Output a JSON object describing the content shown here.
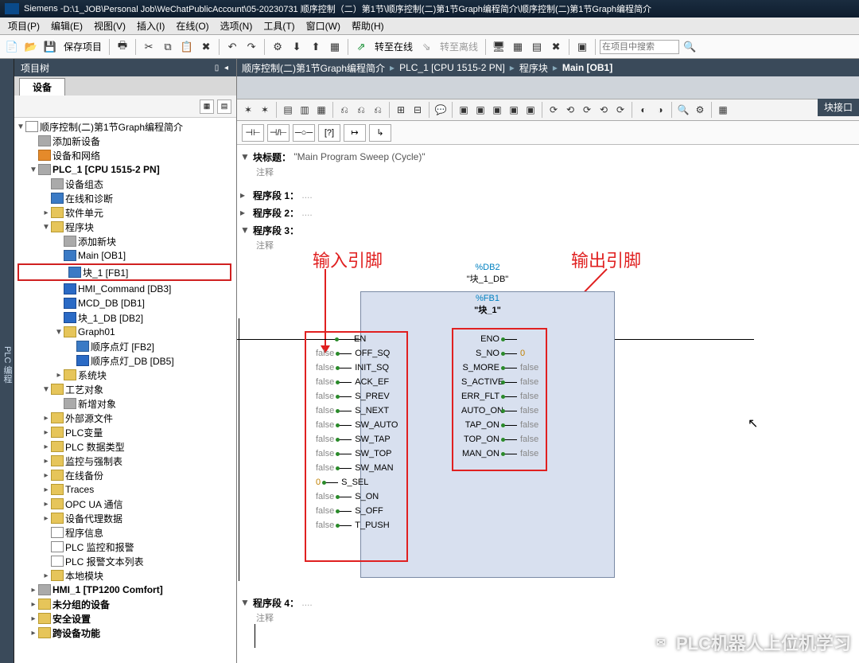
{
  "title_prefix": "Siemens  -  ",
  "title_path": "D:\\1_JOB\\Personal Job\\WeChatPublicAccount\\05-20230731 顺序控制（二）第1节\\顺序控制(二)第1节Graph编程简介\\顺序控制(二)第1节Graph编程简介",
  "menu": [
    "项目(P)",
    "编辑(E)",
    "视图(V)",
    "插入(I)",
    "在线(O)",
    "选项(N)",
    "工具(T)",
    "窗口(W)",
    "帮助(H)"
  ],
  "toolbar": {
    "save_project": "保存项目",
    "go_online": "转至在线",
    "go_offline": "转至离线",
    "search_placeholder": "在项目中搜索"
  },
  "sidetab": "PLC 编程",
  "tree": {
    "title": "项目树",
    "device_tab": "设备",
    "root": "顺序控制(二)第1节Graph编程简介",
    "add_device": "添加新设备",
    "dev_net": "设备和网络",
    "plc": "PLC_1 [CPU 1515-2 PN]",
    "dev_conf": "设备组态",
    "online_diag": "在线和诊断",
    "sw_units": "软件单元",
    "prog_blocks": "程序块",
    "add_block": "添加新块",
    "main": "Main [OB1]",
    "fb1": "块_1 [FB1]",
    "db3": "HMI_Command [DB3]",
    "db1": "MCD_DB [DB1]",
    "db2": "块_1_DB [DB2]",
    "graph01": "Graph01",
    "fb2": "顺序点灯 [FB2]",
    "db5": "顺序点灯_DB [DB5]",
    "sys_blocks": "系统块",
    "tech": "工艺对象",
    "add_obj": "新增对象",
    "ext_src": "外部源文件",
    "plc_vars": "PLC变量",
    "plc_types": "PLC 数据类型",
    "watch": "监控与强制表",
    "backup": "在线备份",
    "traces": "Traces",
    "opcua": "OPC UA 通信",
    "proxy": "设备代理数据",
    "prog_info": "程序信息",
    "plc_mon": "PLC 监控和报警",
    "plc_alarm": "PLC 报警文本列表",
    "local_mod": "本地模块",
    "hmi": "HMI_1 [TP1200 Comfort]",
    "ungrouped": "未分组的设备",
    "security": "安全设置",
    "cross": "跨设备功能"
  },
  "breadcrumb": [
    "顺序控制(二)第1节Graph编程简介",
    "PLC_1 [CPU 1515-2 PN]",
    "程序块",
    "Main [OB1]"
  ],
  "right_tab": "块接口",
  "block_title_label": "块标题：",
  "block_title_value": "\"Main Program Sweep (Cycle)\"",
  "comment_lbl": "注释",
  "seg1": "程序段 1：",
  "seg2": "程序段 2：",
  "seg3": "程序段 3：",
  "seg4": "程序段 4：",
  "dots": "....",
  "anno_in": "输入引脚",
  "anno_out": "输出引脚",
  "fb": {
    "db_ref": "%DB2",
    "db_name": "\"块_1_DB\"",
    "fb_ref": "%FB1",
    "fb_name": "\"块_1\"",
    "in_pins": [
      {
        "name": "EN",
        "val": ""
      },
      {
        "name": "OFF_SQ",
        "val": "false"
      },
      {
        "name": "INIT_SQ",
        "val": "false"
      },
      {
        "name": "ACK_EF",
        "val": "false"
      },
      {
        "name": "S_PREV",
        "val": "false"
      },
      {
        "name": "S_NEXT",
        "val": "false"
      },
      {
        "name": "SW_AUTO",
        "val": "false"
      },
      {
        "name": "SW_TAP",
        "val": "false"
      },
      {
        "name": "SW_TOP",
        "val": "false"
      },
      {
        "name": "SW_MAN",
        "val": "false"
      },
      {
        "name": "S_SEL",
        "val": "0"
      },
      {
        "name": "S_ON",
        "val": "false"
      },
      {
        "name": "S_OFF",
        "val": "false"
      },
      {
        "name": "T_PUSH",
        "val": "false"
      }
    ],
    "out_pins": [
      {
        "name": "ENO",
        "val": ""
      },
      {
        "name": "S_NO",
        "val": "0"
      },
      {
        "name": "S_MORE",
        "val": "false"
      },
      {
        "name": "S_ACTIVE",
        "val": "false"
      },
      {
        "name": "ERR_FLT",
        "val": "false"
      },
      {
        "name": "AUTO_ON",
        "val": "false"
      },
      {
        "name": "TAP_ON",
        "val": "false"
      },
      {
        "name": "TOP_ON",
        "val": "false"
      },
      {
        "name": "MAN_ON",
        "val": "false"
      }
    ]
  },
  "watermark": "PLC机器人上位机学习"
}
